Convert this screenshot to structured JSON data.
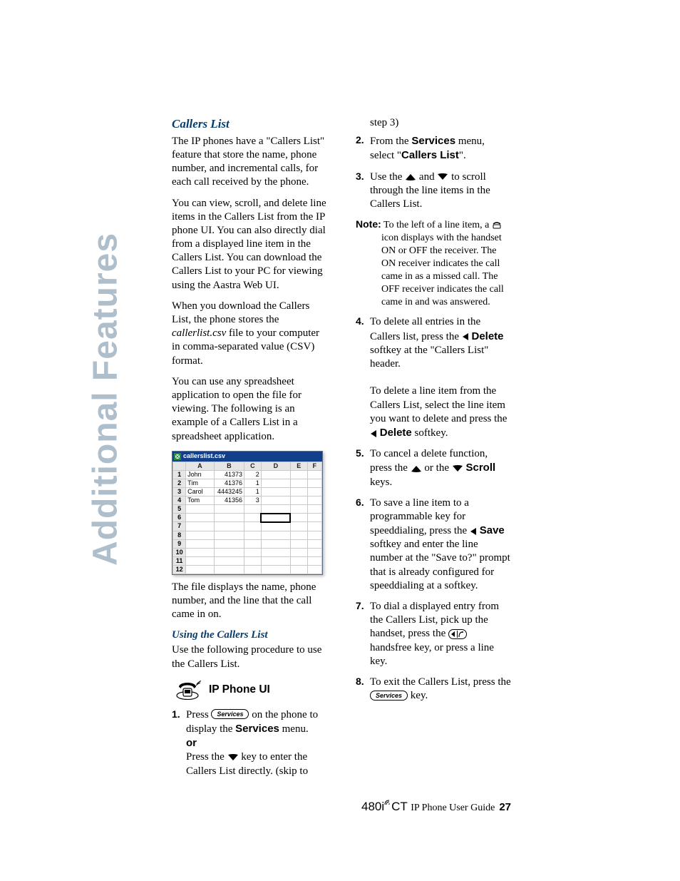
{
  "sidebar_label": "Additional Features",
  "headings": {
    "callers_list": "Callers List",
    "using_callers_list": "Using the Callers List",
    "ip_phone_ui": "IP Phone UI"
  },
  "paragraphs": {
    "intro": "The IP phones have a \"Callers List\" feature that store the name, phone number, and incremental calls, for each call received by the phone.",
    "p2": "You can view, scroll, and delete line items in the Callers List from the IP phone UI. You can also directly dial from a displayed line item in the Callers List. You can download the Callers List to your PC for viewing using the Aastra Web UI.",
    "p3a": "When you download the Callers List, the phone stores the ",
    "p3_file": "callerlist.csv",
    "p3b": " file to your computer in comma-separated value (CSV) format.",
    "p4": "You can use any spreadsheet application to open the file for viewing. The following is an example of a Callers List in a spreadsheet application.",
    "p5": "The file displays the name, phone number, and the line that the call came in on.",
    "using_intro": "Use the following procedure to use the Callers List."
  },
  "spreadsheet": {
    "title": "callerslist.csv",
    "cols": [
      "A",
      "B",
      "C",
      "D",
      "E",
      "F"
    ],
    "rows": [
      [
        "1",
        "John",
        "41373",
        "2",
        "",
        "",
        ""
      ],
      [
        "2",
        "Tim",
        "41376",
        "1",
        "",
        "",
        ""
      ],
      [
        "3",
        "Carol",
        "4443245",
        "1",
        "",
        "",
        ""
      ],
      [
        "4",
        "Tom",
        "41356",
        "3",
        "",
        "",
        ""
      ],
      [
        "5",
        "",
        "",
        "",
        "",
        "",
        ""
      ],
      [
        "6",
        "",
        "",
        "",
        "",
        "",
        ""
      ],
      [
        "7",
        "",
        "",
        "",
        "",
        "",
        ""
      ],
      [
        "8",
        "",
        "",
        "",
        "",
        "",
        ""
      ],
      [
        "9",
        "",
        "",
        "",
        "",
        "",
        ""
      ],
      [
        "10",
        "",
        "",
        "",
        "",
        "",
        ""
      ],
      [
        "11",
        "",
        "",
        "",
        "",
        "",
        ""
      ],
      [
        "12",
        "",
        "",
        "",
        "",
        "",
        ""
      ]
    ]
  },
  "steps_left": {
    "s1a": "Press ",
    "s1_key": "Services",
    "s1b": " on the phone to display the ",
    "s1_bold": "Services",
    "s1c": " menu.",
    "s1_or": "or",
    "s1d": "Press the ",
    "s1e": " key to enter the Callers List directly. (skip to "
  },
  "right_top": "step 3)",
  "steps_right": {
    "s2a": "From the ",
    "s2_bold1": "Services",
    "s2b": " menu, select \"",
    "s2_bold2": "Callers List",
    "s2c": "\".",
    "s3a": "Use the ",
    "s3b": " and ",
    "s3c": " to scroll through the line items in the Callers List.",
    "note_label": "Note:",
    "note_a": " To the left of a line item, a ",
    "note_b": " icon displays with the handset ON or OFF the receiver. The ON receiver indicates the call came in as a missed call. The OFF receiver indicates the call came in and was answered.",
    "s4a": "To delete all entries in the Callers list, press the ",
    "s4_bold1": "Delete",
    "s4b": " softkey at the \"Callers List\" header.",
    "s4c": "To delete a line item from the Callers List, select the line item you want to delete and press the ",
    "s4_bold2": "Delete",
    "s4d": " softkey.",
    "s5a": "To cancel a delete function, press the ",
    "s5b": " or the ",
    "s5_bold": "Scroll",
    "s5c": " keys.",
    "s6a": "To save a line item to a programmable key for speeddialing, press the ",
    "s6_bold": "Save",
    "s6b": " softkey and enter the line number at the \"Save to?\" prompt that is already configured for speeddialing at a softkey.",
    "s7a": "To dial a displayed entry from the Callers List, pick up the handset, press the ",
    "s7b": " handsfree key, or press a line key.",
    "s8a": "To exit the Callers List, press the ",
    "s8_key": "Services",
    "s8b": " key."
  },
  "footer": {
    "model_pre": "480i",
    "model_sup": "CT",
    "guide": " IP Phone User Guide",
    "page": "27"
  }
}
